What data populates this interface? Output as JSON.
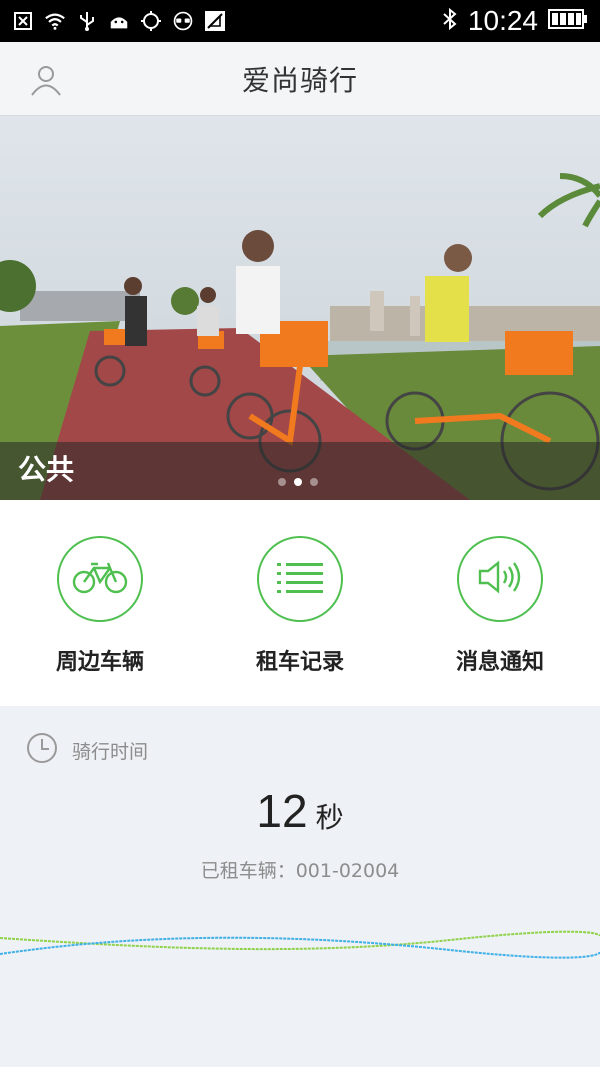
{
  "status_bar": {
    "time": "10:24",
    "icons": [
      "close-box-icon",
      "wifi-icon",
      "usb-icon",
      "android-icon",
      "gps-icon",
      "glasses-icon",
      "no-signal-icon",
      "bluetooth-icon",
      "battery-icon"
    ]
  },
  "header": {
    "title": "爱尚骑行",
    "user_icon": "user-icon"
  },
  "banner": {
    "caption": "公共",
    "dots_total": 3,
    "active_dot": 2
  },
  "actions": [
    {
      "label": "周边车辆",
      "icon": "bicycle-icon"
    },
    {
      "label": "租车记录",
      "icon": "list-icon"
    },
    {
      "label": "消息通知",
      "icon": "speaker-icon"
    }
  ],
  "ride": {
    "header_label": "骑行时间",
    "time_value": "12",
    "time_unit": "秒",
    "vehicle": "已租车辆：001-02004"
  },
  "colors": {
    "accent_green": "#4fc04f",
    "wave_blue": "#3fb0e8",
    "wave_green": "#8fd14a"
  }
}
